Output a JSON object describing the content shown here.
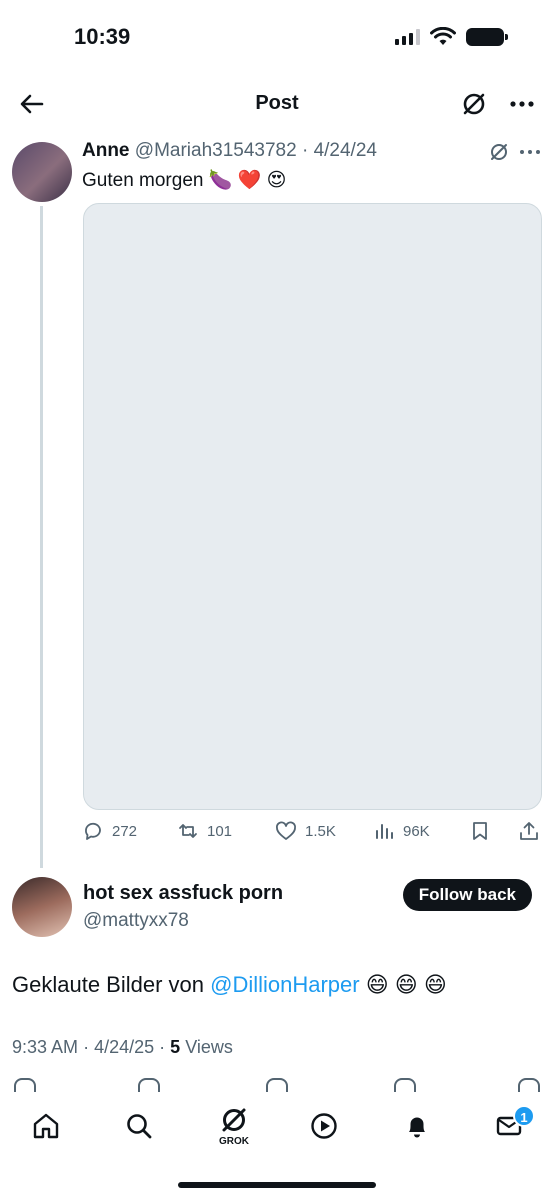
{
  "status_bar": {
    "time": "10:39"
  },
  "header": {
    "title": "Post"
  },
  "quoted_post": {
    "display_name": "Anne",
    "handle": "@Mariah31543782",
    "separator": "·",
    "date": "4/24/24",
    "text": "Guten morgen 🍆 ❤️ 😍",
    "stats": {
      "replies": "272",
      "reposts": "101",
      "likes": "1.5K",
      "views": "96K"
    }
  },
  "reply": {
    "display_name": "hot sex assfuck porn",
    "handle": "@mattyxx78",
    "follow_label": "Follow back",
    "text_before": "Geklaute Bilder von ",
    "mention": "@DillionHarper",
    "text_after": " 😄 😄 😄",
    "time": "9:33 AM",
    "dot": "·",
    "date": "4/24/25",
    "views_count": "5",
    "views_label": "Views"
  },
  "nav": {
    "grok_label": "GROK",
    "messages_badge": "1"
  },
  "icons": {
    "back": "arrow-left-icon",
    "grok": "grok-icon",
    "more": "more-horizontal-icon",
    "reply": "reply-icon",
    "repost": "repost-icon",
    "like": "heart-icon",
    "views": "views-icon",
    "bookmark": "bookmark-icon",
    "share": "share-icon"
  },
  "colors": {
    "accent": "#1d9bf0",
    "text": "#0f1419",
    "muted": "#536471"
  }
}
